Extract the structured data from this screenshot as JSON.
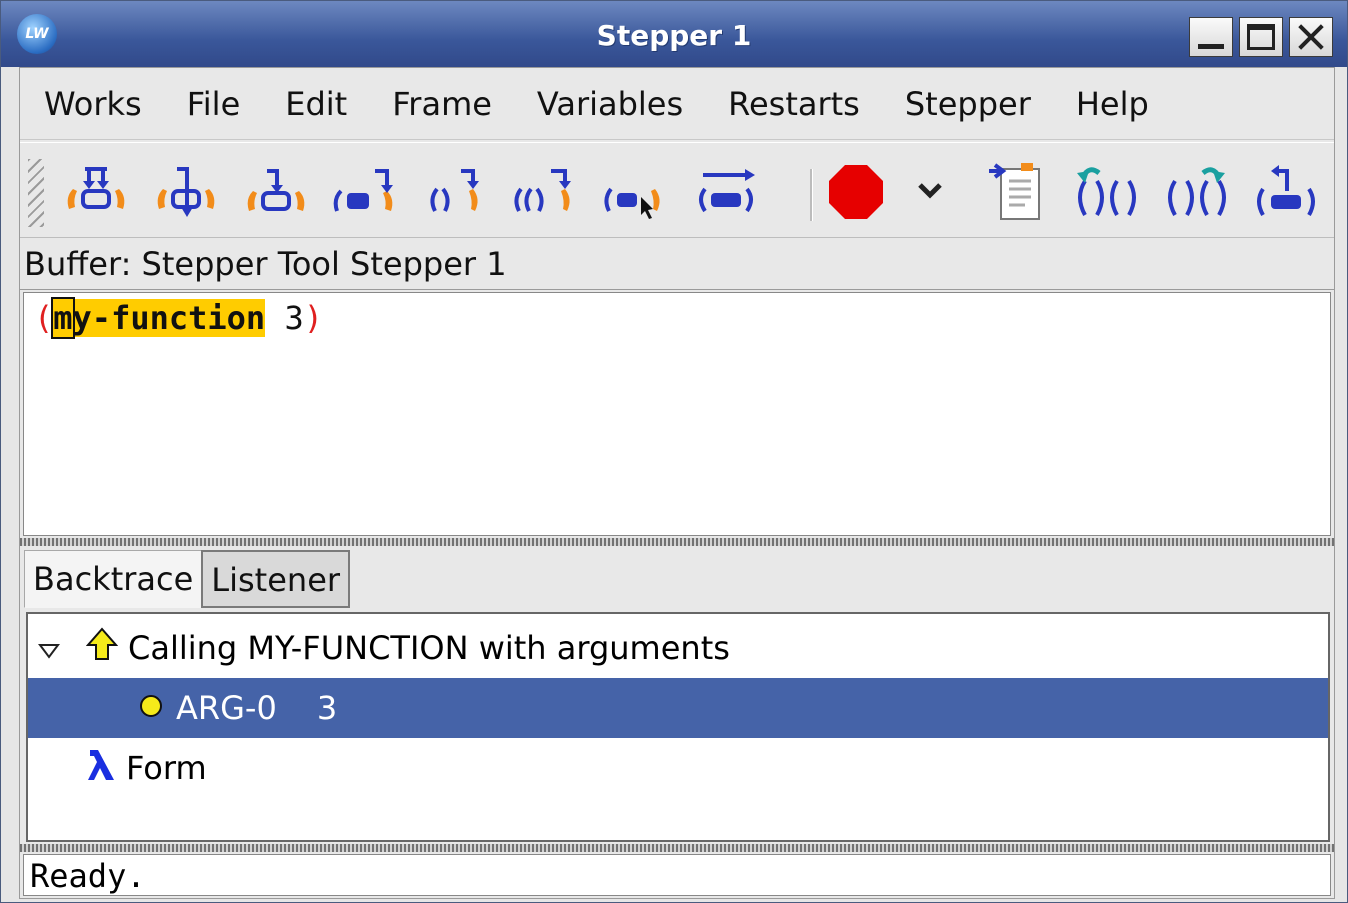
{
  "window": {
    "title": "Stepper 1",
    "logo": "LW"
  },
  "menubar": {
    "items": [
      "Works",
      "File",
      "Edit",
      "Frame",
      "Variables",
      "Restarts",
      "Stepper",
      "Help"
    ]
  },
  "toolbar": {
    "buttons": [
      "step-icon",
      "step-through-call-icon",
      "step-into-icon",
      "step-over-icon",
      "step-to-value-icon",
      "step-to-call-icon",
      "step-to-cursor-icon",
      "step-to-end-icon",
      "stop-icon",
      "dropdown-arrow-icon",
      "copy-buffer-icon",
      "undo-step-icon",
      "redo-step-icon",
      "return-icon"
    ]
  },
  "buffer": {
    "label": "Buffer: Stepper Tool Stepper 1"
  },
  "editor": {
    "open_paren": "(",
    "cursor_char": "m",
    "function_rest": "y-function",
    "argument": " 3",
    "close_paren": ")"
  },
  "tabs": [
    "Backtrace",
    "Listener"
  ],
  "tree": {
    "rows": [
      {
        "label": "Calling MY-FUNCTION with arguments",
        "icon": "up-arrow-icon"
      },
      {
        "label": "ARG-0",
        "value": "3",
        "icon": "yellow-dot-icon",
        "selected": true
      },
      {
        "label": "Form",
        "icon": "lambda-icon"
      }
    ]
  },
  "status": {
    "text": "Ready."
  },
  "colors": {
    "titlebar": "#3a579a",
    "selection": "#4563a8",
    "highlight": "#ffcc00",
    "paren": "#e02020"
  }
}
